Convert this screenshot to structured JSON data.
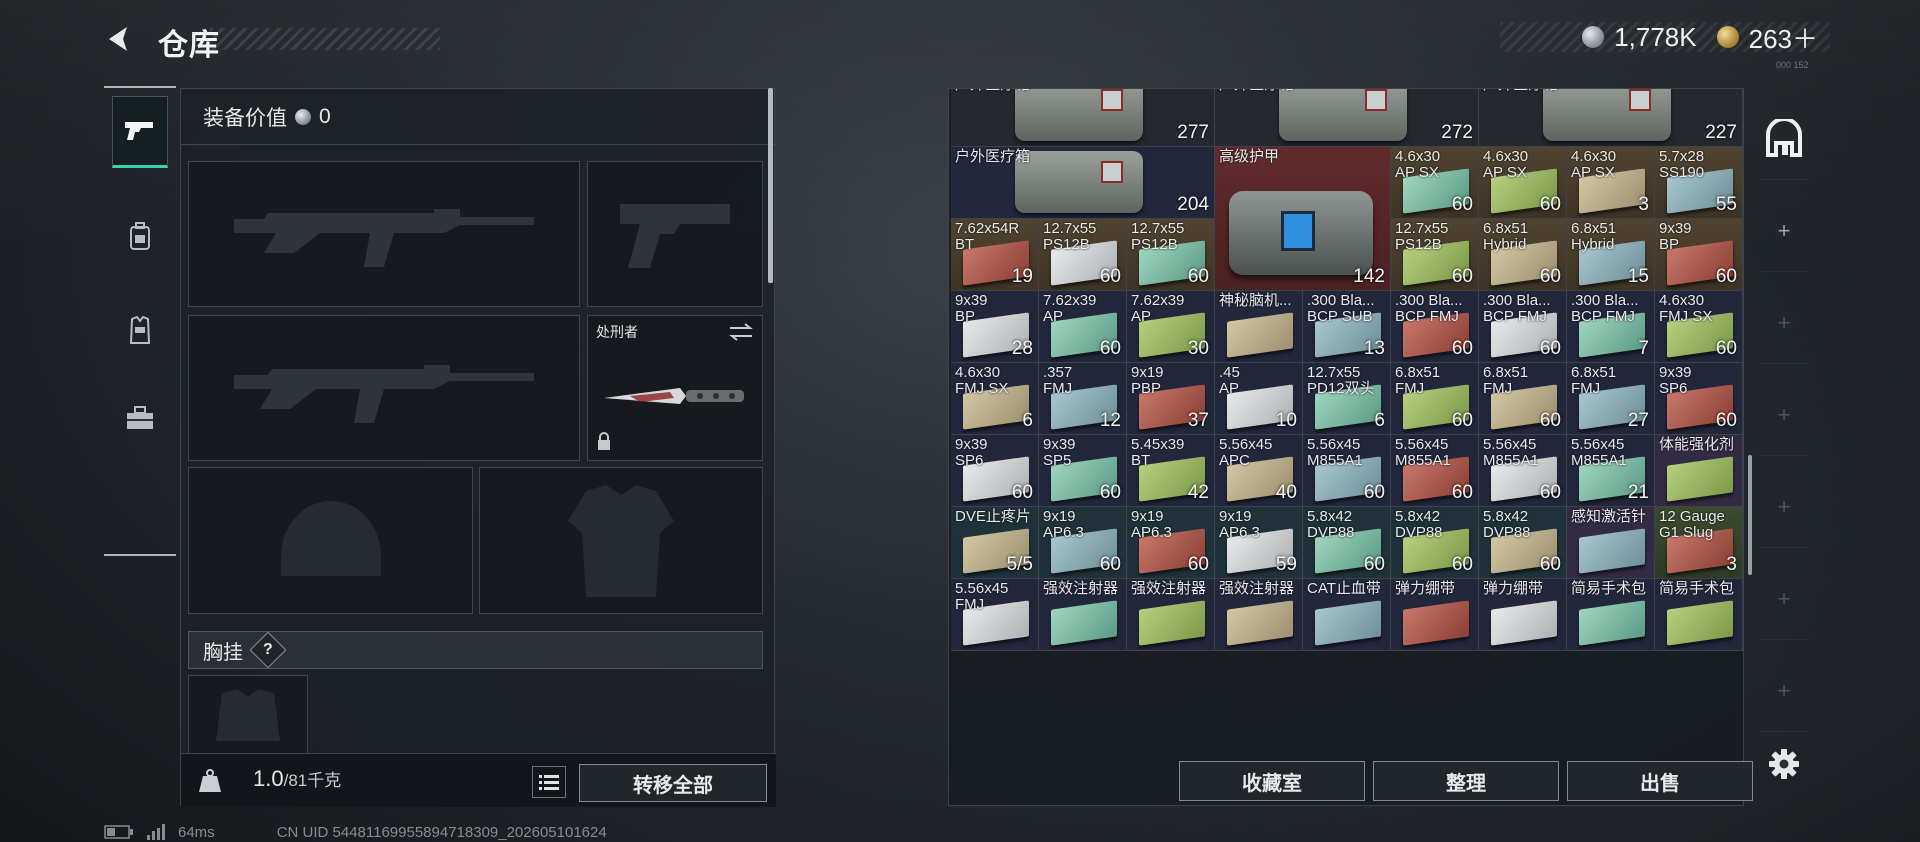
{
  "header": {
    "title": "仓库",
    "currencies": [
      {
        "icon": "silver-coin-icon",
        "value": "1,778K"
      },
      {
        "icon": "gold-coin-icon",
        "value": "263＋"
      }
    ],
    "version_mark": "000 152"
  },
  "left_tabs": [
    {
      "icon": "pistol-icon",
      "active": true
    },
    {
      "icon": "backpack-icon",
      "active": false
    },
    {
      "icon": "vest-icon",
      "active": false
    },
    {
      "icon": "toolbox-icon",
      "active": false
    }
  ],
  "equipment": {
    "value_label": "装备价值",
    "value": "0",
    "melee_name": "处刑者",
    "chest_rig_label": "胸挂",
    "chest_rig_help": "?",
    "weight_current": "1.0",
    "weight_max": "/81千克",
    "transfer_all_label": "转移全部"
  },
  "storage": {
    "items": [
      {
        "name": "户外医疗箱",
        "count": "277",
        "color": "c-grey"
      },
      {
        "name": "户外医疗箱",
        "count": "272",
        "color": "c-grey"
      },
      {
        "name": "户外医疗箱",
        "count": "227",
        "color": "c-grey"
      },
      {
        "name": "户外医疗箱",
        "count": "204",
        "color": "c-navy"
      },
      {
        "name": "高级护甲",
        "count": "142",
        "color": "c-red"
      },
      {
        "name": "4.6x30\nAP SX",
        "count": "60",
        "color": "c-brown"
      },
      {
        "name": "4.6x30\nAP SX",
        "count": "60",
        "color": "c-brown"
      },
      {
        "name": "4.6x30\nAP SX",
        "count": "3",
        "color": "c-brown"
      },
      {
        "name": "5.7x28\nSS190",
        "count": "55",
        "color": "c-brown"
      },
      {
        "name": "7.62x54R\nBT",
        "count": "19",
        "color": "c-brown"
      },
      {
        "name": "12.7x55\nPS12B",
        "count": "60",
        "color": "c-brown"
      },
      {
        "name": "12.7x55\nPS12B",
        "count": "60",
        "color": "c-brown"
      },
      {
        "name": "12.7x55\nPS12B",
        "count": "60",
        "color": "c-brown"
      },
      {
        "name": "6.8x51\nHybrid",
        "count": "60",
        "color": "c-brown"
      },
      {
        "name": "6.8x51\nHybrid",
        "count": "15",
        "color": "c-brown"
      },
      {
        "name": "9x39\nBP",
        "count": "60",
        "color": "c-brown"
      },
      {
        "name": "9x39\nBP",
        "count": "28",
        "color": "c-navy"
      },
      {
        "name": "7.62x39\nAP",
        "count": "60",
        "color": "c-navy"
      },
      {
        "name": "7.62x39\nAP",
        "count": "30",
        "color": "c-navy"
      },
      {
        "name": "神秘脑机...",
        "count": "",
        "color": "c-navy"
      },
      {
        "name": ".300 Bla...\nBCP SUB",
        "count": "13",
        "color": "c-navy"
      },
      {
        "name": ".300 Bla...\nBCP FMJ",
        "count": "60",
        "color": "c-navy"
      },
      {
        "name": ".300 Bla...\nBCP FMJ",
        "count": "60",
        "color": "c-navy"
      },
      {
        "name": ".300 Bla...\nBCP FMJ",
        "count": "7",
        "color": "c-navy"
      },
      {
        "name": "4.6x30\nFMJ SX",
        "count": "60",
        "color": "c-navy"
      },
      {
        "name": "4.6x30\nFMJ SX",
        "count": "6",
        "color": "c-navy"
      },
      {
        "name": ".357\nFMJ",
        "count": "12",
        "color": "c-navy"
      },
      {
        "name": "9x19\nPBP",
        "count": "37",
        "color": "c-navy"
      },
      {
        "name": ".45\nAP",
        "count": "10",
        "color": "c-navy"
      },
      {
        "name": "12.7x55\nPD12双头",
        "count": "6",
        "color": "c-navy"
      },
      {
        "name": "6.8x51\nFMJ",
        "count": "60",
        "color": "c-navy"
      },
      {
        "name": "6.8x51\nFMJ",
        "count": "60",
        "color": "c-navy"
      },
      {
        "name": "6.8x51\nFMJ",
        "count": "27",
        "color": "c-navy"
      },
      {
        "name": "9x39\nSP6",
        "count": "60",
        "color": "c-navy"
      },
      {
        "name": "9x39\nSP6",
        "count": "60",
        "color": "c-navy"
      },
      {
        "name": "9x39\nSP5",
        "count": "60",
        "color": "c-navy"
      },
      {
        "name": "5.45x39\nBT",
        "count": "42",
        "color": "c-navy"
      },
      {
        "name": "5.56x45\nAPC",
        "count": "40",
        "color": "c-navy"
      },
      {
        "name": "5.56x45\nM855A1",
        "count": "60",
        "color": "c-navy"
      },
      {
        "name": "5.56x45\nM855A1",
        "count": "60",
        "color": "c-navy"
      },
      {
        "name": "5.56x45\nM855A1",
        "count": "60",
        "color": "c-navy"
      },
      {
        "name": "5.56x45\nM855A1",
        "count": "21",
        "color": "c-navy"
      },
      {
        "name": "体能强化剂",
        "count": "",
        "color": "c-purple"
      },
      {
        "name": "DVE止疼片",
        "count": "5/5",
        "color": "c-teal"
      },
      {
        "name": "9x19\nAP6.3",
        "count": "60",
        "color": "c-teal"
      },
      {
        "name": "9x19\nAP6.3",
        "count": "60",
        "color": "c-teal"
      },
      {
        "name": "9x19\nAP6.3",
        "count": "59",
        "color": "c-teal"
      },
      {
        "name": "5.8x42\nDVP88",
        "count": "60",
        "color": "c-teal"
      },
      {
        "name": "5.8x42\nDVP88",
        "count": "60",
        "color": "c-teal"
      },
      {
        "name": "5.8x42\nDVP88",
        "count": "60",
        "color": "c-teal"
      },
      {
        "name": "感知激活针",
        "count": "",
        "color": "c-purple"
      },
      {
        "name": "12 Gauge\nG1 Slug",
        "count": "3",
        "color": "c-green"
      },
      {
        "name": "5.56x45\nFMJ",
        "count": "",
        "color": "c-navy"
      },
      {
        "name": "强效注射器",
        "count": "",
        "color": "c-navy"
      },
      {
        "name": "强效注射器",
        "count": "",
        "color": "c-navy"
      },
      {
        "name": "强效注射器",
        "count": "",
        "color": "c-navy"
      },
      {
        "name": "CAT止血带",
        "count": "",
        "color": "c-navy"
      },
      {
        "name": "弹力绷带",
        "count": "",
        "color": "c-navy"
      },
      {
        "name": "弹力绷带",
        "count": "",
        "color": "c-navy"
      },
      {
        "name": "简易手术包",
        "count": "",
        "color": "c-navy"
      },
      {
        "name": "简易手术包",
        "count": "",
        "color": "c-navy"
      }
    ],
    "buttons": {
      "collection": "收藏室",
      "organize": "整理",
      "sell": "出售"
    }
  },
  "right_tabs": [
    {
      "icon": "storage-home-icon",
      "active": true
    },
    {
      "icon": "add-tab-icon",
      "label": "+"
    },
    {
      "icon": "add-tab-icon",
      "label": "+"
    },
    {
      "icon": "add-tab-icon",
      "label": "+"
    },
    {
      "icon": "add-tab-icon",
      "label": "+"
    },
    {
      "icon": "add-tab-icon",
      "label": "+"
    },
    {
      "icon": "add-tab-icon",
      "label": "+"
    }
  ],
  "status": {
    "ping": "64ms",
    "uid": "CN UID 5448116995589471830​9_202605101624"
  }
}
